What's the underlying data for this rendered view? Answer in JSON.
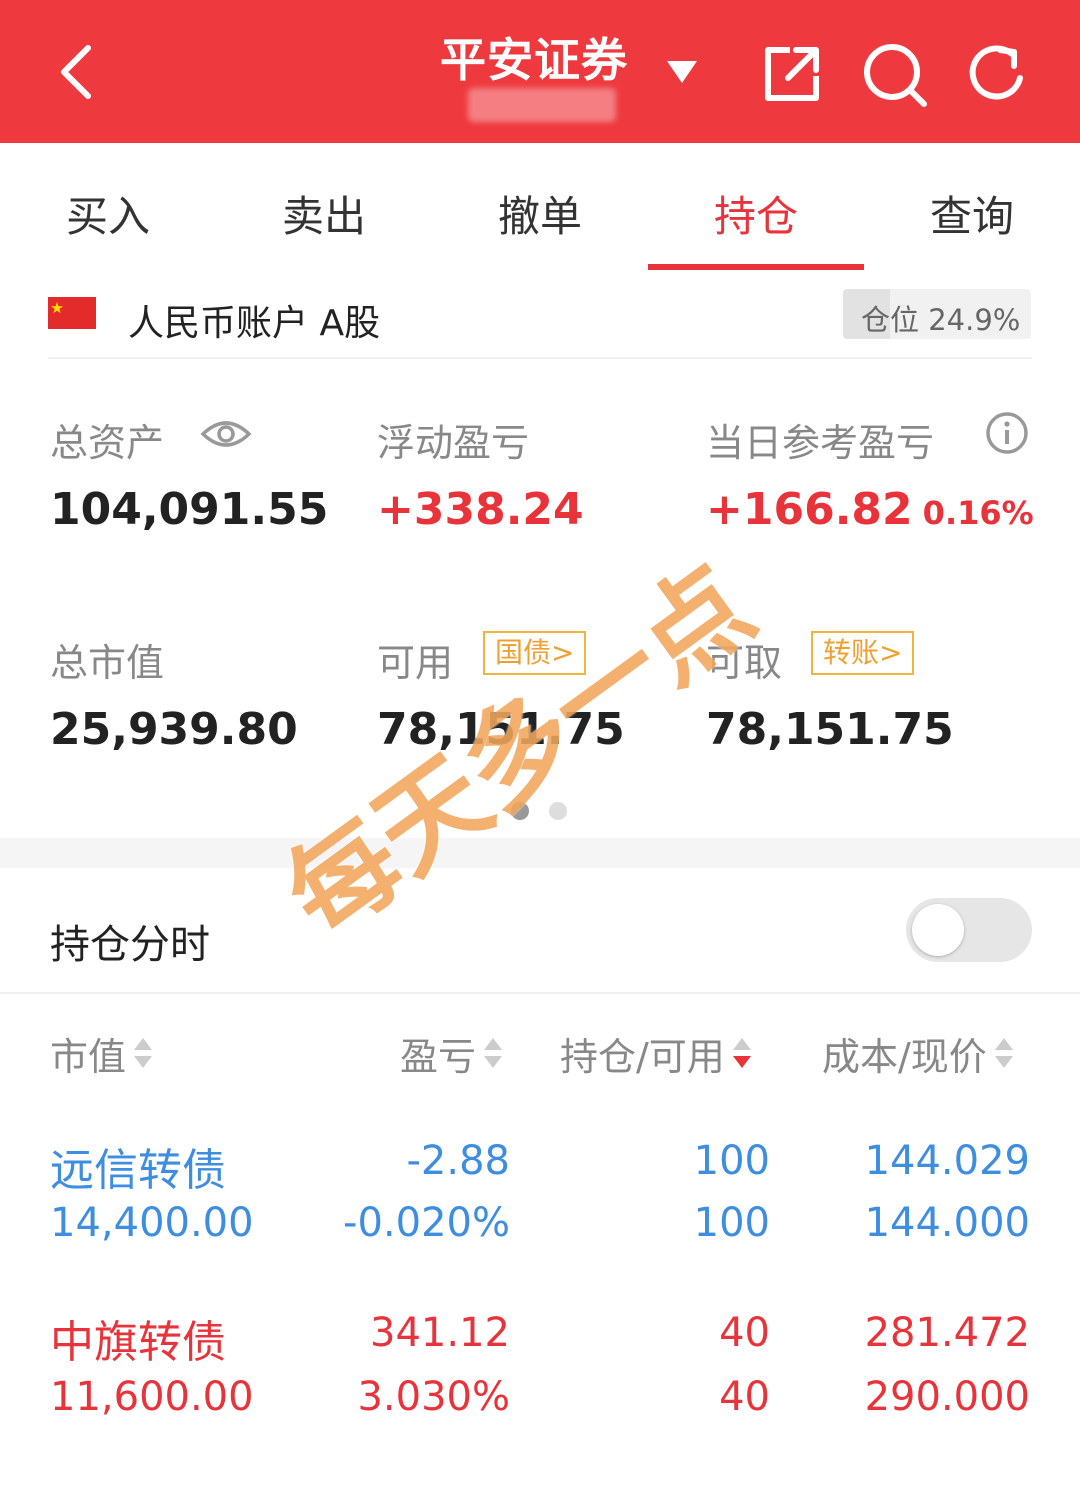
{
  "header": {
    "title": "平安证券",
    "back_icon": "chevron-left-icon",
    "share_icon": "share-icon",
    "search_icon": "search-icon",
    "refresh_icon": "refresh-icon",
    "bg_color": "#ee3a3f"
  },
  "tabs": [
    {
      "label": "买入",
      "active": false
    },
    {
      "label": "卖出",
      "active": false
    },
    {
      "label": "撤单",
      "active": false
    },
    {
      "label": "持仓",
      "active": true
    },
    {
      "label": "查询",
      "active": false
    }
  ],
  "account": {
    "label": "人民币账户 A股",
    "position_text": "仓位 24.9%",
    "position_ratio": 0.249
  },
  "stats": {
    "total_assets": {
      "label": "总资产",
      "value": "104,091.55"
    },
    "floating_pnl": {
      "label": "浮动盈亏",
      "value": "+338.24"
    },
    "daily_pnl": {
      "label": "当日参考盈亏",
      "value": "+166.82",
      "pct": "0.16%"
    },
    "market_value": {
      "label": "总市值",
      "value": "25,939.80"
    },
    "available": {
      "label": "可用",
      "tag": "国债>",
      "value": "78,151.75"
    },
    "withdrawable": {
      "label": "可取",
      "tag": "转账>",
      "value": "78,151.75"
    }
  },
  "page_dots": {
    "count": 2,
    "active_index": 0
  },
  "timeshare": {
    "label": "持仓分时",
    "enabled": false
  },
  "table": {
    "headers": [
      "市值",
      "盈亏",
      "持仓/可用",
      "成本/现价"
    ],
    "rows": [
      {
        "name": "远信转债",
        "market_value": "14,400.00",
        "pnl": "-2.88",
        "pnl_pct": "-0.020%",
        "holding": "100",
        "available": "100",
        "cost": "144.029",
        "price": "144.000",
        "color": "#3d8de0"
      },
      {
        "name": "中旗转债",
        "market_value": "11,600.00",
        "pnl": "341.12",
        "pnl_pct": "3.030%",
        "holding": "40",
        "available": "40",
        "cost": "281.472",
        "price": "290.000",
        "color": "#e8333a"
      }
    ]
  },
  "watermark": "每天多一点",
  "colors": {
    "accent": "#e8333a",
    "loss": "#3d8de0",
    "tag": "#f0a030"
  }
}
